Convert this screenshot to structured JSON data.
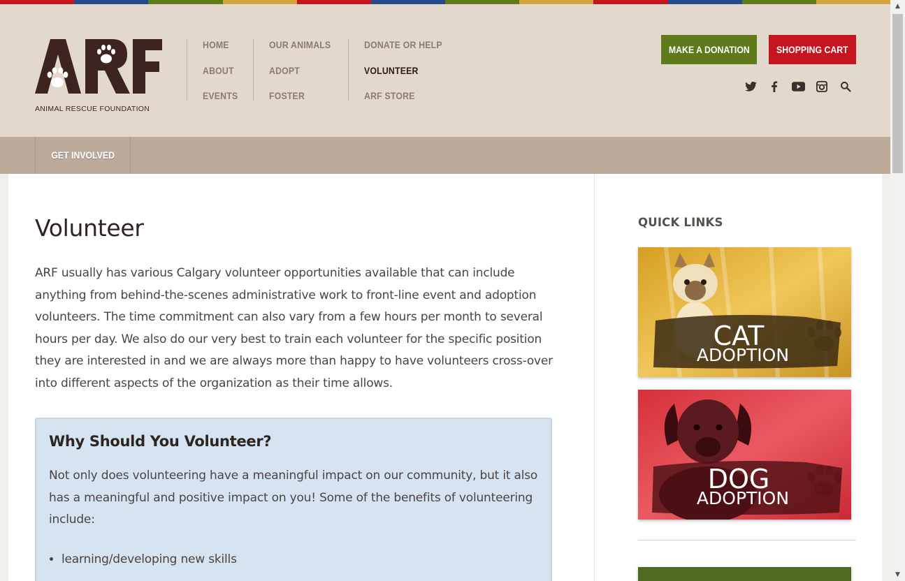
{
  "colors": {
    "stripe": [
      "#c5161f",
      "#244b87",
      "#5f7a1a",
      "#d4a33b",
      "#c5161f",
      "#244b87",
      "#5f7a1a",
      "#d4a33b",
      "#c5161f",
      "#244b87",
      "#5f7a1a",
      "#d4a33b"
    ],
    "brand_dark": "#3d2421",
    "donate_green": "#5f7a1a",
    "cart_red": "#c5161f",
    "callout_bg": "#d6e3f1"
  },
  "logo": {
    "letters": "ARF",
    "subtitle": "ANIMAL RESCUE FOUNDATION"
  },
  "nav": {
    "col1": [
      "HOME",
      "ABOUT",
      "EVENTS"
    ],
    "col2": [
      "OUR ANIMALS",
      "ADOPT",
      "FOSTER"
    ],
    "col3": [
      "DONATE OR HELP",
      "VOLUNTEER",
      "ARF STORE"
    ],
    "active": "VOLUNTEER"
  },
  "header_buttons": {
    "donate": "MAKE A DONATION",
    "cart": "SHOPPING CART"
  },
  "social_icons": [
    "twitter-icon",
    "facebook-icon",
    "youtube-icon",
    "instagram-icon",
    "search-icon"
  ],
  "subnav": {
    "tab": "GET INVOLVED"
  },
  "main": {
    "title": "Volunteer",
    "intro": "ARF usually has various Calgary volunteer opportunities available that can include anything from behind-the-scenes administrative work to front-line event and adoption volunteers. The time commitment can also vary from a few hours per month to several hours per day. We also do our very best to train each volunteer for the specific position they are interested in and we are always more than happy to have volunteers cross-over into different aspects of the organization as their time allows.",
    "callout": {
      "heading": "Why Should You Volunteer?",
      "text": "Not only does volunteering have a meaningful impact on our community, but it also has a meaningful and positive impact on you! Some of the benefits of volunteering include:",
      "bullets": [
        "learning/developing new skills"
      ]
    }
  },
  "sidebar": {
    "heading": "QUICK LINKS",
    "cards": [
      {
        "line1": "CAT",
        "line2": "ADOPTION"
      },
      {
        "line1": "DOG",
        "line2": "ADOPTION"
      }
    ]
  }
}
